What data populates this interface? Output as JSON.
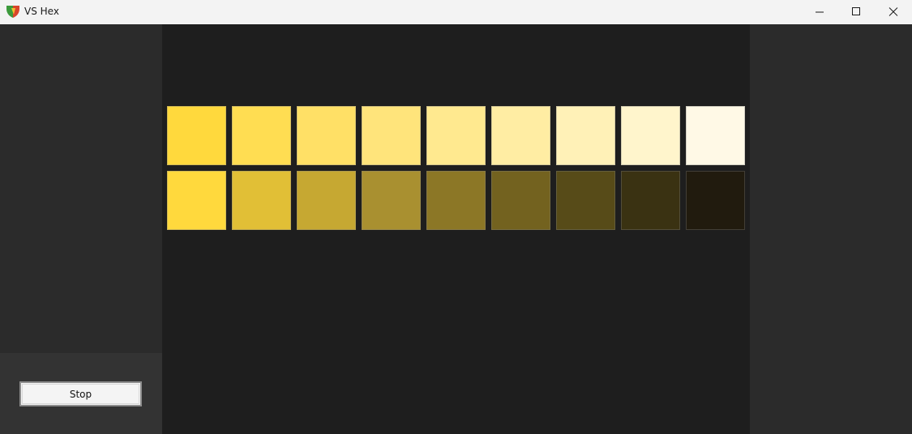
{
  "window": {
    "title": "VS Hex",
    "app_icon": "shield-icon",
    "controls": {
      "minimize_icon": "minimize-icon",
      "maximize_icon": "maximize-icon",
      "close_icon": "close-icon"
    }
  },
  "sidebar": {
    "stop_label": "Stop"
  },
  "palette": {
    "tints": [
      "#ffd93d",
      "#ffdd52",
      "#ffe066",
      "#ffe47b",
      "#ffe98f",
      "#ffeda3",
      "#fff1b7",
      "#fff5cc",
      "#fff9e6"
    ],
    "shades": [
      "#ffd93d",
      "#e1bf36",
      "#c6a832",
      "#a99030",
      "#8c7726",
      "#73621f",
      "#574b18",
      "#3a3212",
      "#211b0e"
    ]
  }
}
